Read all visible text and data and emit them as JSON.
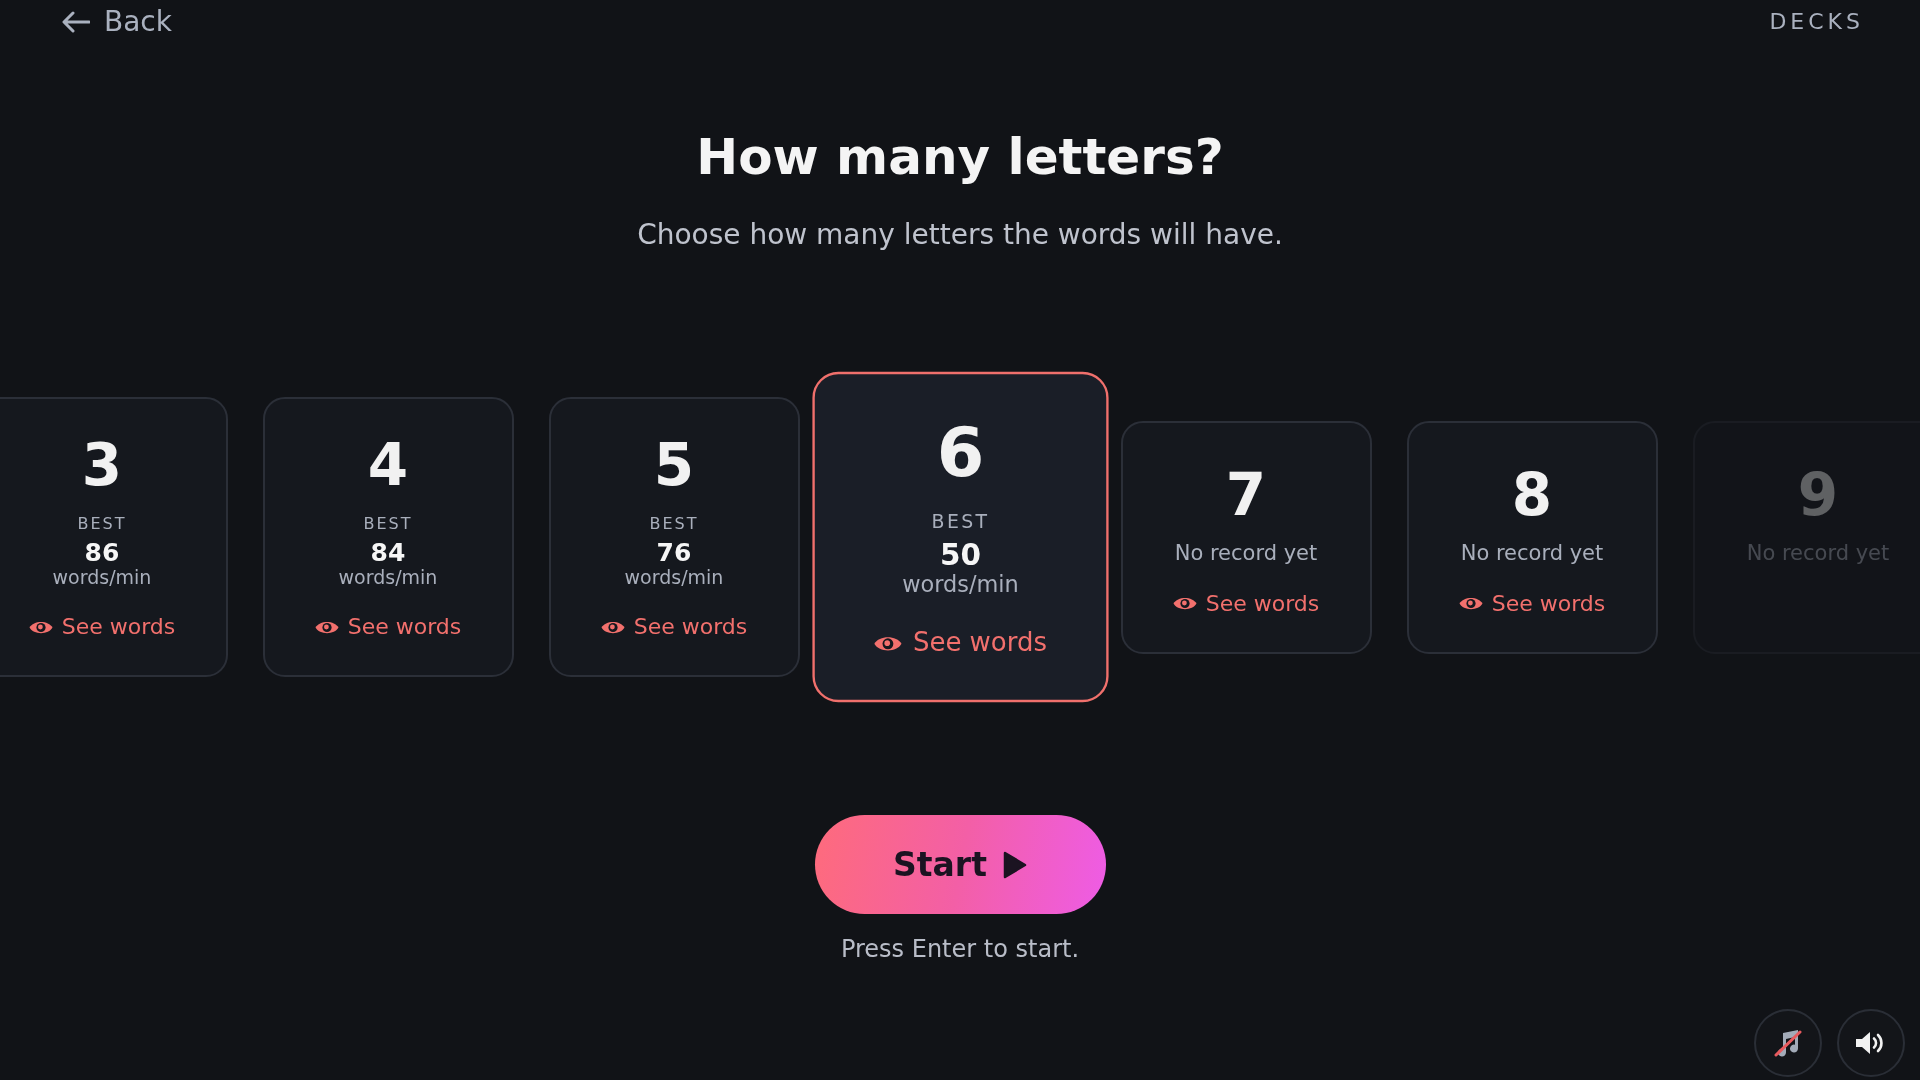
{
  "nav": {
    "back": "Back",
    "decks": "DECKS"
  },
  "title": "How many letters?",
  "subtitle": "Choose how many letters the words will have.",
  "cards": [
    {
      "kind": "record",
      "letters": "3",
      "best_label": "BEST",
      "best": "86",
      "unit": "words/min",
      "link": "See words",
      "selected": false,
      "disabled": false
    },
    {
      "kind": "record",
      "letters": "4",
      "best_label": "BEST",
      "best": "84",
      "unit": "words/min",
      "link": "See words",
      "selected": false,
      "disabled": false
    },
    {
      "kind": "record",
      "letters": "5",
      "best_label": "BEST",
      "best": "76",
      "unit": "words/min",
      "link": "See words",
      "selected": false,
      "disabled": false
    },
    {
      "kind": "record",
      "letters": "6",
      "best_label": "BEST",
      "best": "50",
      "unit": "words/min",
      "link": "See words",
      "selected": true,
      "disabled": false
    },
    {
      "kind": "empty",
      "letters": "7",
      "note": "No record yet",
      "link": "See words",
      "selected": false,
      "disabled": false
    },
    {
      "kind": "empty",
      "letters": "8",
      "note": "No record yet",
      "link": "See words",
      "selected": false,
      "disabled": false
    },
    {
      "kind": "empty",
      "letters": "9",
      "note": "No record yet",
      "selected": false,
      "disabled": true
    }
  ],
  "start_button": "Start",
  "hint": "Press Enter to start.",
  "controls": [
    {
      "kind": "music",
      "on": false
    },
    {
      "kind": "sound",
      "on": true
    }
  ]
}
